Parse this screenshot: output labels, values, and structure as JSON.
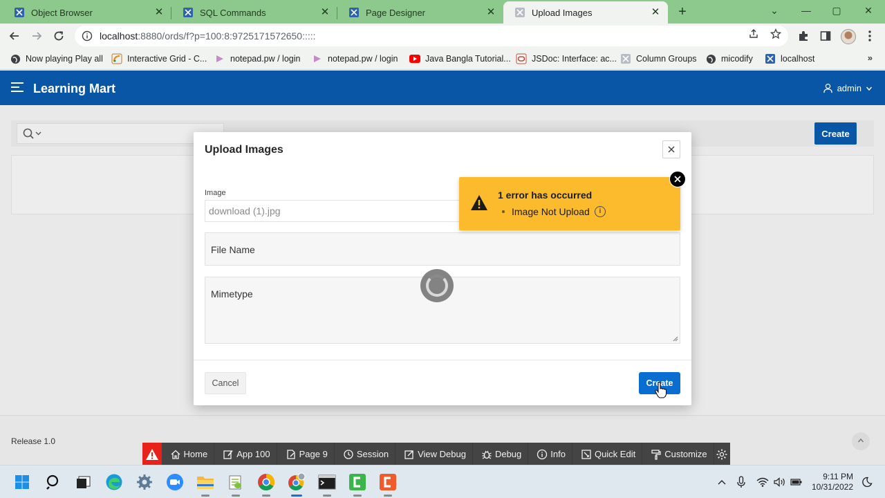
{
  "browser": {
    "tabs": [
      {
        "label": "Object Browser",
        "close": "✕"
      },
      {
        "label": "SQL Commands",
        "close": "✕"
      },
      {
        "label": "Page Designer",
        "close": "✕"
      },
      {
        "label": "Upload Images",
        "close": "✕"
      }
    ],
    "new_tab": "+",
    "window_controls": {
      "minimize": "⌄",
      "restore": "—",
      "maximize": "▢",
      "close": "✕"
    },
    "url_host": "localhost",
    "url_rest": ":8880/ords/f?p=100:8:9725171572650:::::",
    "bookmarks": [
      "Now playing Play all",
      "Interactive Grid - C...",
      "notepad.pw / login",
      "notepad.pw / login",
      "Java Bangla Tutorial...",
      "JSDoc: Interface: ac...",
      "Column Groups",
      "micodify",
      "localhost"
    ],
    "bookmarks_more": "»"
  },
  "app": {
    "title": "Learning Mart",
    "user": "admin",
    "create_label": "Create",
    "release": "Release 1.0"
  },
  "dialog": {
    "title": "Upload Images",
    "image_label": "Image",
    "image_value": "download (1).jpg",
    "file_name_label": "File Name",
    "mimetype_label": "Mimetype",
    "cancel_label": "Cancel",
    "create_label": "Create"
  },
  "error": {
    "title": "1 error has occurred",
    "message": "Image Not Upload",
    "info_glyph": "i"
  },
  "devbar": {
    "items": [
      "Home",
      "App 100",
      "Page 9",
      "Session",
      "View Debug",
      "Debug",
      "Info",
      "Quick Edit",
      "Customize"
    ]
  },
  "taskbar": {
    "time": "9:11 PM",
    "date": "10/31/2022"
  },
  "colors": {
    "apex_header": "#0a56a6",
    "error_bg": "#fcbb2c",
    "create_btn": "#0a6ed1",
    "devbar_bg": "#444444",
    "devbar_warn": "#e8221a",
    "tabstrip": "#8dc88d"
  }
}
